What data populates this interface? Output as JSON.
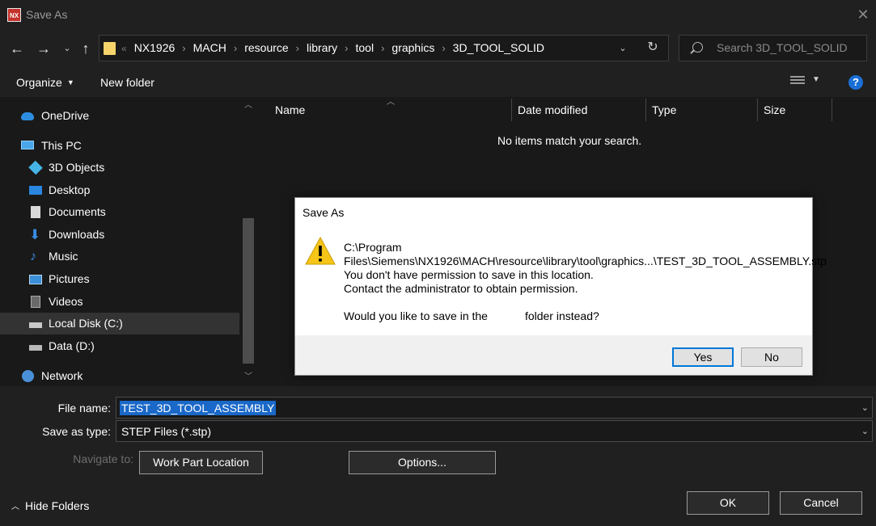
{
  "window": {
    "app_icon_text": "NX",
    "title": "Save As",
    "close_glyph": "✕"
  },
  "nav": {
    "back_glyph": "←",
    "forward_glyph": "→",
    "recent_glyph": "⌄",
    "up_glyph": "↑",
    "breadcrumb_lead": "«",
    "breadcrumbs": [
      "NX1926",
      "MACH",
      "resource",
      "library",
      "tool",
      "graphics",
      "3D_TOOL_SOLID"
    ],
    "search_placeholder": "Search 3D_TOOL_SOLID"
  },
  "toolbar": {
    "organize_label": "Organize",
    "new_folder_label": "New folder",
    "help_glyph": "?"
  },
  "sidebar": {
    "items": [
      {
        "label": "OneDrive",
        "icon": "cloud-icon"
      },
      {
        "label": "This PC",
        "icon": "computer-icon"
      },
      {
        "label": "3D Objects",
        "icon": "cube-icon"
      },
      {
        "label": "Desktop",
        "icon": "desktop-icon"
      },
      {
        "label": "Documents",
        "icon": "document-icon"
      },
      {
        "label": "Downloads",
        "icon": "download-arrow-icon"
      },
      {
        "label": "Music",
        "icon": "music-note-icon"
      },
      {
        "label": "Pictures",
        "icon": "picture-icon"
      },
      {
        "label": "Videos",
        "icon": "video-icon"
      },
      {
        "label": "Local Disk (C:)",
        "icon": "disk-drive-icon",
        "selected": true
      },
      {
        "label": "Data (D:)",
        "icon": "disk-drive-icon"
      },
      {
        "label": "Network",
        "icon": "network-icon"
      }
    ]
  },
  "filelist": {
    "columns": [
      "Name",
      "Date modified",
      "Type",
      "Size"
    ],
    "empty_message": "No items match your search."
  },
  "form": {
    "file_name_label": "File name:",
    "file_name_value": "TEST_3D_TOOL_ASSEMBLY",
    "save_type_label": "Save as type:",
    "save_type_value": "STEP Files (*.stp)",
    "navigate_label": "Navigate to:",
    "work_part_button": "Work Part Location",
    "options_button": "Options...",
    "hide_folders_label": "Hide Folders",
    "ok_button": "OK",
    "cancel_button": "Cancel"
  },
  "dialog": {
    "title": "Save As",
    "path_line1": "C:\\Program",
    "path_line2": "Files\\Siemens\\NX1926\\MACH\\resource\\library\\tool\\graphics...\\TEST_3D_TOOL_ASSEMBLY.stp",
    "message_line1": "You don't have permission to save in this location.",
    "message_line2": "Contact the administrator to obtain permission.",
    "question_part1": "Would you like to save in the",
    "question_part2": "folder instead?",
    "yes_button": "Yes",
    "no_button": "No"
  },
  "colors": {
    "accent": "#0078d7",
    "selection": "#1a68c8",
    "warning": "#f5c518"
  }
}
